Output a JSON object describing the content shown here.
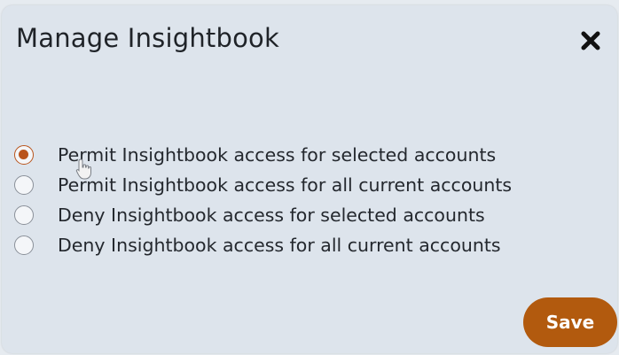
{
  "dialog": {
    "title": "Manage Insightbook",
    "close_icon": "close-icon",
    "options": [
      {
        "label": "Permit Insightbook access for selected accounts",
        "checked": true
      },
      {
        "label": "Permit Insightbook access for all current accounts",
        "checked": false
      },
      {
        "label": "Deny Insightbook access for selected accounts",
        "checked": false
      },
      {
        "label": "Deny Insightbook access for all current accounts",
        "checked": false
      }
    ],
    "save_label": "Save"
  },
  "colors": {
    "accent": "#b9541c",
    "save_button": "#b25a0e",
    "dialog_background": "#dde4ec"
  }
}
